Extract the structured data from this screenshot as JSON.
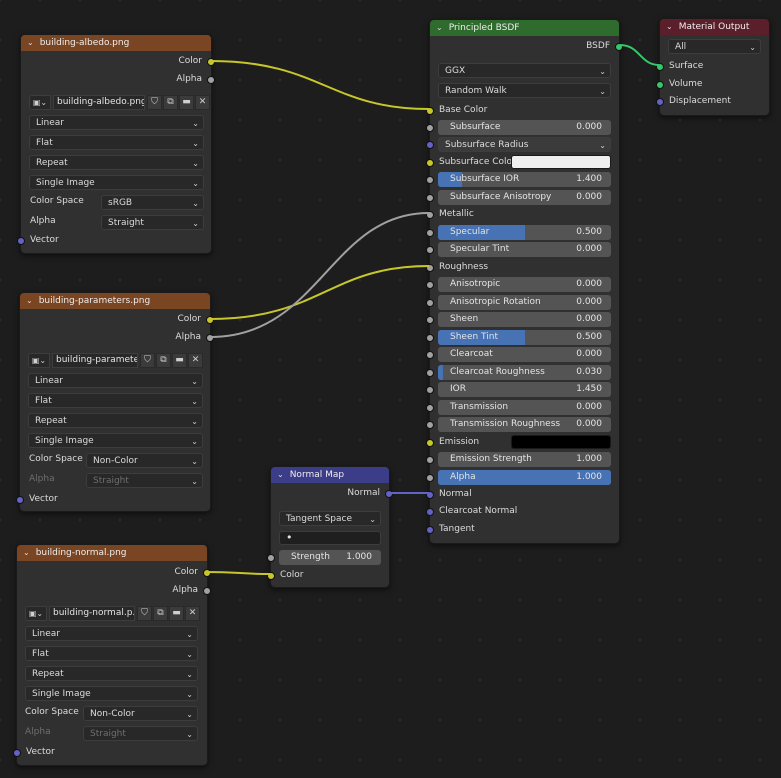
{
  "colors": {
    "yellow_wire": "#c7c729",
    "gray_wire": "#a1a1a1",
    "purple_wire": "#6363c7",
    "green_wire": "#35c76a",
    "slider_fill": "#4772b3",
    "texture_header": "#7a4522",
    "bsdf_header": "#2f6b2c",
    "output_header": "#5a1f2a",
    "vector_header": "#3c3d88"
  },
  "tex_albedo": {
    "title": "building-albedo.png",
    "out_color": "Color",
    "out_alpha": "Alpha",
    "image_name": "building-albedo.png",
    "interpolation": "Linear",
    "projection": "Flat",
    "extension": "Repeat",
    "source": "Single Image",
    "color_space_label": "Color Space",
    "color_space": "sRGB",
    "alpha_label": "Alpha",
    "alpha": "Straight",
    "in_vector": "Vector"
  },
  "tex_params": {
    "title": "building-parameters.png",
    "out_color": "Color",
    "out_alpha": "Alpha",
    "image_name": "building-paramete...",
    "interpolation": "Linear",
    "projection": "Flat",
    "extension": "Repeat",
    "source": "Single Image",
    "color_space_label": "Color Space",
    "color_space": "Non-Color",
    "alpha_label": "Alpha",
    "alpha": "Straight",
    "in_vector": "Vector"
  },
  "tex_normal": {
    "title": "building-normal.png",
    "out_color": "Color",
    "out_alpha": "Alpha",
    "image_name": "building-normal.p...",
    "interpolation": "Linear",
    "projection": "Flat",
    "extension": "Repeat",
    "source": "Single Image",
    "color_space_label": "Color Space",
    "color_space": "Non-Color",
    "alpha_label": "Alpha",
    "alpha": "Straight",
    "in_vector": "Vector"
  },
  "normal_map": {
    "title": "Normal Map",
    "out_normal": "Normal",
    "space": "Tangent Space",
    "uv_map": "•",
    "strength_label": "Strength",
    "strength_value": "1.000",
    "in_color": "Color"
  },
  "bsdf": {
    "title": "Principled BSDF",
    "out_bsdf": "BSDF",
    "distribution": "GGX",
    "subsurface_method": "Random Walk",
    "base_color": "Base Color",
    "subsurface": {
      "label": "Subsurface",
      "value": "0.000",
      "fill": 0.0
    },
    "subsurface_radius": "Subsurface Radius",
    "subsurface_color": "Subsurface Colo",
    "subsurface_color_swatch": "#efefef",
    "subsurface_ior": {
      "label": "Subsurface IOR",
      "value": "1.400",
      "fill": 0.14
    },
    "subsurface_anisotropy": {
      "label": "Subsurface Anisotropy",
      "value": "0.000",
      "fill": 0.0
    },
    "metallic": "Metallic",
    "specular": {
      "label": "Specular",
      "value": "0.500",
      "fill": 0.5
    },
    "specular_tint": {
      "label": "Specular Tint",
      "value": "0.000",
      "fill": 0.0
    },
    "roughness": "Roughness",
    "anisotropic": {
      "label": "Anisotropic",
      "value": "0.000",
      "fill": 0.0
    },
    "anisotropic_rotation": {
      "label": "Anisotropic Rotation",
      "value": "0.000",
      "fill": 0.0
    },
    "sheen": {
      "label": "Sheen",
      "value": "0.000",
      "fill": 0.0
    },
    "sheen_tint": {
      "label": "Sheen Tint",
      "value": "0.500",
      "fill": 0.5
    },
    "clearcoat": {
      "label": "Clearcoat",
      "value": "0.000",
      "fill": 0.0
    },
    "clearcoat_roughness": {
      "label": "Clearcoat Roughness",
      "value": "0.030",
      "fill": 0.03
    },
    "ior": {
      "label": "IOR",
      "value": "1.450",
      "fill": 0.0
    },
    "transmission": {
      "label": "Transmission",
      "value": "0.000",
      "fill": 0.0
    },
    "transmission_roughness": {
      "label": "Transmission Roughness",
      "value": "0.000",
      "fill": 0.0
    },
    "emission": "Emission",
    "emission_swatch": "#000000",
    "emission_strength": {
      "label": "Emission Strength",
      "value": "1.000",
      "fill": 0.0
    },
    "alpha": {
      "label": "Alpha",
      "value": "1.000",
      "fill": 1.0
    },
    "normal": "Normal",
    "clearcoat_normal": "Clearcoat Normal",
    "tangent": "Tangent"
  },
  "output": {
    "title": "Material Output",
    "target": "All",
    "surface": "Surface",
    "volume": "Volume",
    "displacement": "Displacement"
  }
}
